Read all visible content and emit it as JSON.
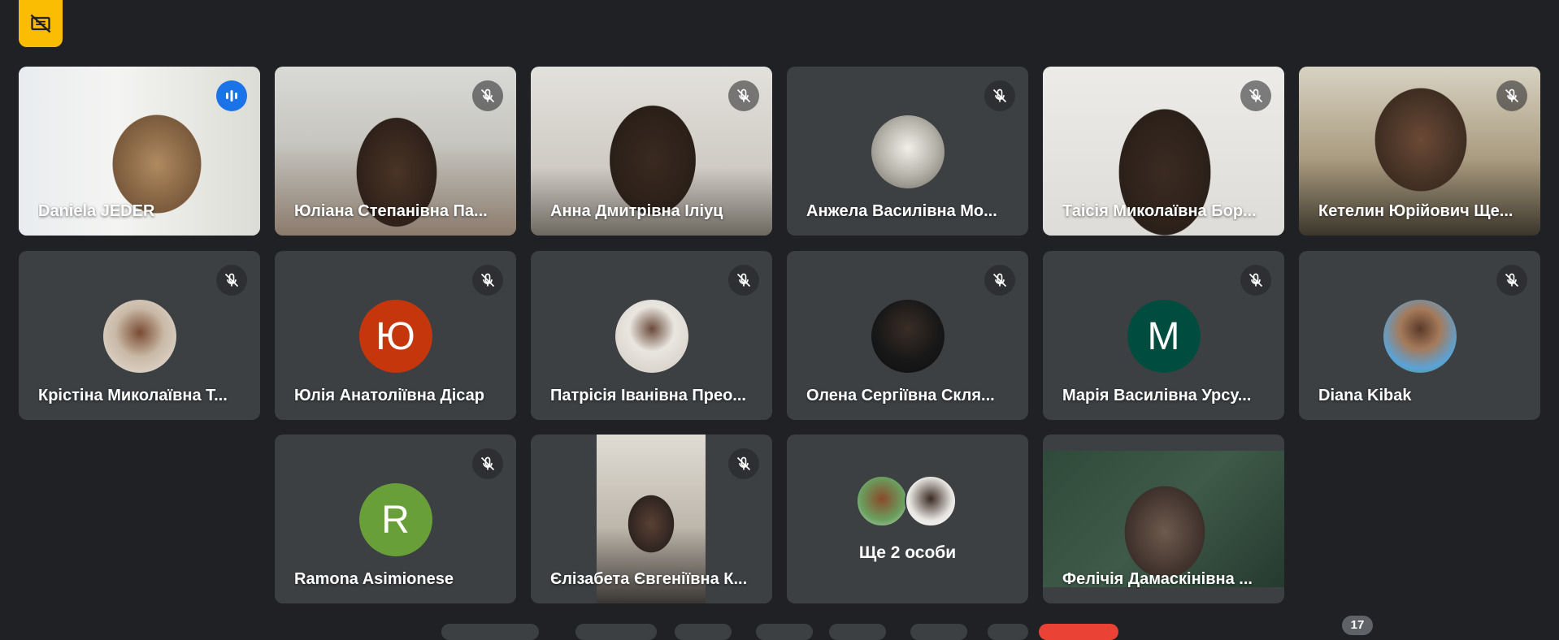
{
  "tiles": [
    {
      "name": "Daniela JEDER"
    },
    {
      "name": "Юліана Степанівна Па..."
    },
    {
      "name": "Анна Дмитрівна Іліуц"
    },
    {
      "name": "Анжела Василівна Мо..."
    },
    {
      "name": "Таісія Миколаївна Бор..."
    },
    {
      "name": "Кетелин Юрійович Ще..."
    },
    {
      "name": "Крістіна Миколаївна Т..."
    },
    {
      "name": "Юлія Анатоліївна Дісар",
      "initial": "Ю"
    },
    {
      "name": "Патрісія Іванівна Прео..."
    },
    {
      "name": "Олена Сергіївна Скля..."
    },
    {
      "name": "Марія Василівна Урсу...",
      "initial": "M"
    },
    {
      "name": "Diana Kibak"
    },
    {
      "name": "Ramona Asimionese",
      "initial": "R"
    },
    {
      "name": "Єлізабета Євгеніївна К..."
    },
    {
      "more_label": "Ще 2 особи"
    },
    {
      "name": "Фелічія Дамаскінівна ..."
    }
  ],
  "participant_count": "17",
  "colors": {
    "background": "#202124",
    "tile": "#3c4043",
    "speaking_accent": "#8ab4f8",
    "badge": "#fbbc04"
  }
}
